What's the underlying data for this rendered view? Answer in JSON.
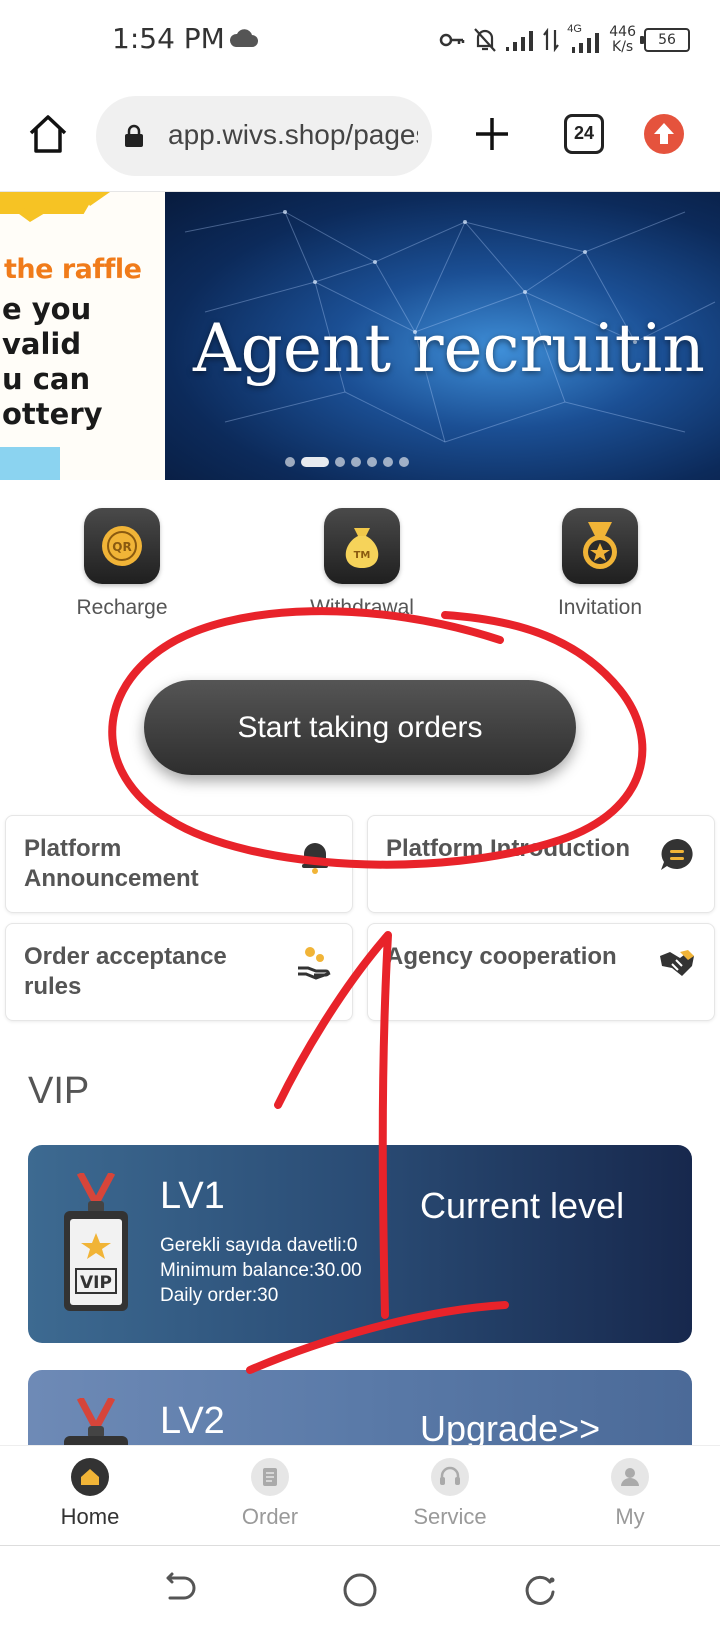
{
  "status_bar": {
    "time": "1:54 PM",
    "net_type": "4G",
    "net_speed_value": "446",
    "net_speed_unit": "K/s",
    "battery": "56"
  },
  "browser": {
    "url": "app.wivs.shop/pages",
    "tab_count": "24"
  },
  "banner": {
    "left_slide_highlight": "the raffle",
    "left_slide_lines": "e you\nvalid\nu can\nottery",
    "title": "Agent recruitin"
  },
  "quick_actions": [
    {
      "label": "Recharge",
      "icon": "qr-coin-icon"
    },
    {
      "label": "Withdrawal",
      "icon": "money-bag-icon"
    },
    {
      "label": "Invitation",
      "icon": "medal-icon"
    }
  ],
  "start_button": {
    "label": "Start taking orders"
  },
  "cards": [
    {
      "label": "Platform Announcement",
      "icon": "bell-icon"
    },
    {
      "label": "Platform Introduction",
      "icon": "chat-bubble-icon"
    },
    {
      "label": "Order acceptance rules",
      "icon": "hand-coins-icon"
    },
    {
      "label": "Agency cooperation",
      "icon": "handshake-icon"
    }
  ],
  "vip": {
    "heading": "VIP",
    "levels": [
      {
        "level": "LV1",
        "details": [
          "Gerekli sayıda davetli:0",
          "Minimum balance:30.00",
          "Daily order:30"
        ],
        "status": "Current level"
      },
      {
        "level": "LV2",
        "details": [],
        "status": "Upgrade>>"
      }
    ]
  },
  "bottom_nav": [
    {
      "label": "Home",
      "icon": "home-icon",
      "active": true
    },
    {
      "label": "Order",
      "icon": "order-icon",
      "active": false
    },
    {
      "label": "Service",
      "icon": "service-icon",
      "active": false
    },
    {
      "label": "My",
      "icon": "user-icon",
      "active": false
    }
  ],
  "colors": {
    "annotation_red": "#e8232a",
    "button_dark": "#333333",
    "update_orange": "#e5533d"
  }
}
